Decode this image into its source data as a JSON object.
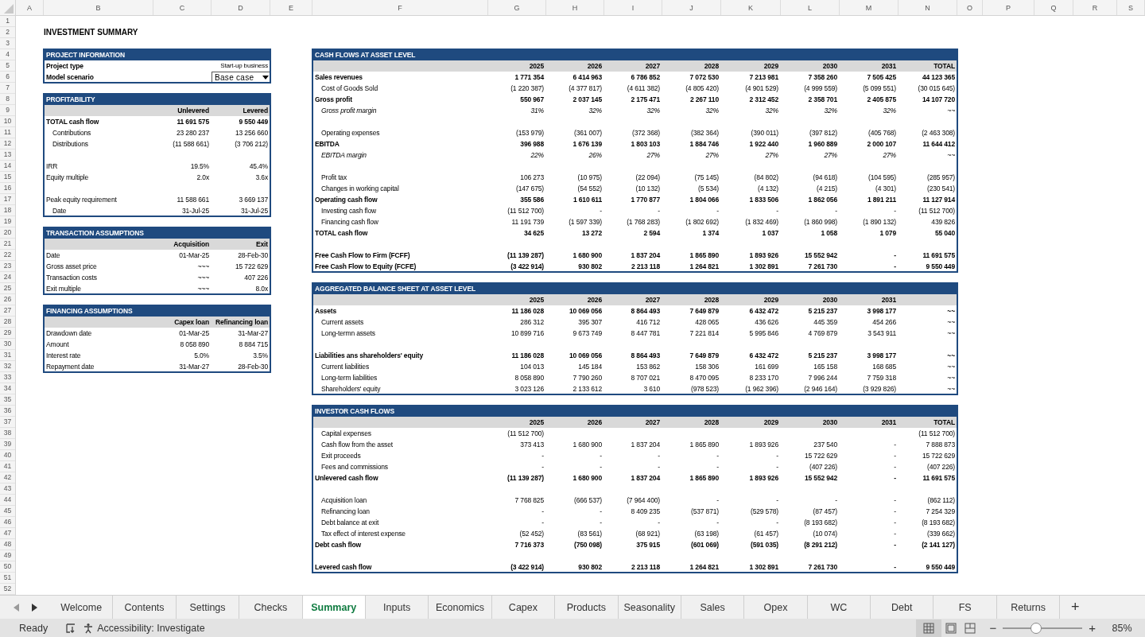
{
  "column_headers": [
    "A",
    "B",
    "C",
    "D",
    "E",
    "F",
    "G",
    "H",
    "I",
    "J",
    "K",
    "L",
    "M",
    "N",
    "O",
    "P",
    "Q",
    "R",
    "S"
  ],
  "row_numbers": [
    "1",
    "2",
    "3",
    "4",
    "5",
    "6",
    "7",
    "8",
    "9",
    "10",
    "11",
    "12",
    "13",
    "14",
    "15",
    "16",
    "17",
    "18",
    "19",
    "20",
    "21",
    "22",
    "23",
    "24",
    "25",
    "26",
    "27",
    "28",
    "29",
    "30",
    "31",
    "32",
    "33",
    "34",
    "35",
    "36",
    "37",
    "38",
    "39",
    "40",
    "41",
    "42",
    "43",
    "44",
    "45",
    "46",
    "47",
    "48",
    "49",
    "50",
    "51",
    "52"
  ],
  "title": "INVESTMENT SUMMARY",
  "left_sections": [
    {
      "title": "PROJECT INFORMATION",
      "rows": [
        {
          "kind": "field",
          "label": "Project type",
          "values": [
            "Start-up business"
          ]
        },
        {
          "kind": "dropdown",
          "label": "Model scenario",
          "values": [
            "Base case"
          ]
        }
      ]
    },
    {
      "title": "PROFITABILITY",
      "columns": [
        "Unlevered",
        "Levered"
      ],
      "rows": [
        {
          "kind": "bold",
          "label": "TOTAL cash flow",
          "values": [
            "11 691 575",
            "9 550 449"
          ]
        },
        {
          "kind": "sub",
          "label": "Contributions",
          "values": [
            "23 280 237",
            "13 256 660"
          ]
        },
        {
          "kind": "sub",
          "label": "Distributions",
          "values": [
            "(11 588 661)",
            "(3 706 212)"
          ]
        },
        {
          "kind": "blank"
        },
        {
          "kind": "plain",
          "label": "IRR",
          "values": [
            "19.5%",
            "45.4%"
          ]
        },
        {
          "kind": "plain",
          "label": "Equity multiple",
          "values": [
            "2.0x",
            "3.6x"
          ]
        },
        {
          "kind": "blank"
        },
        {
          "kind": "plain",
          "label": "Peak equity requirement",
          "values": [
            "11 588 661",
            "3 669 137"
          ]
        },
        {
          "kind": "sub",
          "label": "Date",
          "values": [
            "31-Jul-25",
            "31-Jul-25"
          ]
        }
      ]
    },
    {
      "title": "TRANSACTION ASSUMPTIONS",
      "columns": [
        "Acquisition",
        "Exit"
      ],
      "rows": [
        {
          "kind": "plain",
          "label": "Date",
          "values": [
            "01-Mar-25",
            "28-Feb-30"
          ]
        },
        {
          "kind": "plain",
          "label": "Gross asset price",
          "values": [
            "~~~",
            "15 722 629"
          ]
        },
        {
          "kind": "plain",
          "label": "Transaction costs",
          "values": [
            "~~~",
            "407 226"
          ]
        },
        {
          "kind": "plain",
          "label": "Exit multiple",
          "values": [
            "~~~",
            "8.0x"
          ]
        }
      ]
    },
    {
      "title": "FINANCING ASSUMPTIONS",
      "columns": [
        "Capex loan",
        "Refinancing loan"
      ],
      "rows": [
        {
          "kind": "plain",
          "label": "Drawdown date",
          "values": [
            "01-Mar-25",
            "31-Mar-27"
          ]
        },
        {
          "kind": "plain",
          "label": "Amount",
          "values": [
            "8 058 890",
            "8 884 715"
          ]
        },
        {
          "kind": "plain",
          "label": "Interest rate",
          "values": [
            "5.0%",
            "3.5%"
          ]
        },
        {
          "kind": "plain",
          "label": "Repayment date",
          "values": [
            "31-Mar-27",
            "28-Feb-30"
          ]
        }
      ]
    }
  ],
  "right_sections": [
    {
      "title": "CASH FLOWS AT ASSET LEVEL",
      "columns": [
        "2025",
        "2026",
        "2027",
        "2028",
        "2029",
        "2030",
        "2031",
        "TOTAL"
      ],
      "rows": [
        {
          "kind": "bold",
          "label": "Sales revenues",
          "values": [
            "1 771 354",
            "6 414 963",
            "6 786 852",
            "7 072 530",
            "7 213 981",
            "7 358 260",
            "7 505 425",
            "44 123 365"
          ]
        },
        {
          "kind": "sub",
          "label": "Cost of Goods Sold",
          "values": [
            "(1 220 387)",
            "(4 377 817)",
            "(4 611 382)",
            "(4 805 420)",
            "(4 901 529)",
            "(4 999 559)",
            "(5 099 551)",
            "(30 015 645)"
          ]
        },
        {
          "kind": "bold",
          "label": "Gross profit",
          "values": [
            "550 967",
            "2 037 145",
            "2 175 471",
            "2 267 110",
            "2 312 452",
            "2 358 701",
            "2 405 875",
            "14 107 720"
          ]
        },
        {
          "kind": "italic",
          "label": "Gross profit margin",
          "values": [
            "31%",
            "32%",
            "32%",
            "32%",
            "32%",
            "32%",
            "32%",
            "~~"
          ]
        },
        {
          "kind": "blank"
        },
        {
          "kind": "sub",
          "label": "Operating expenses",
          "values": [
            "(153 979)",
            "(361 007)",
            "(372 368)",
            "(382 364)",
            "(390 011)",
            "(397 812)",
            "(405 768)",
            "(2 463 308)"
          ]
        },
        {
          "kind": "bold",
          "label": "EBITDA",
          "values": [
            "396 988",
            "1 676 139",
            "1 803 103",
            "1 884 746",
            "1 922 440",
            "1 960 889",
            "2 000 107",
            "11 644 412"
          ]
        },
        {
          "kind": "italic",
          "label": "EBITDA margin",
          "values": [
            "22%",
            "26%",
            "27%",
            "27%",
            "27%",
            "27%",
            "27%",
            "~~"
          ]
        },
        {
          "kind": "blank"
        },
        {
          "kind": "sub",
          "label": "Profit tax",
          "values": [
            "106 273",
            "(10 975)",
            "(22 094)",
            "(75 145)",
            "(84 802)",
            "(94 618)",
            "(104 595)",
            "(285 957)"
          ]
        },
        {
          "kind": "sub",
          "label": "Changes in working capital",
          "values": [
            "(147 675)",
            "(54 552)",
            "(10 132)",
            "(5 534)",
            "(4 132)",
            "(4 215)",
            "(4 301)",
            "(230 541)"
          ]
        },
        {
          "kind": "bold",
          "label": "Operating cash flow",
          "values": [
            "355 586",
            "1 610 611",
            "1 770 877",
            "1 804 066",
            "1 833 506",
            "1 862 056",
            "1 891 211",
            "11 127 914"
          ]
        },
        {
          "kind": "sub",
          "label": "Investing cash flow",
          "values": [
            "(11 512 700)",
            "-",
            "-",
            "-",
            "-",
            "-",
            "-",
            "(11 512 700)"
          ]
        },
        {
          "kind": "sub",
          "label": "Financing cash flow",
          "values": [
            "11 191 739",
            "(1 597 339)",
            "(1 768 283)",
            "(1 802 692)",
            "(1 832 469)",
            "(1 860 998)",
            "(1 890 132)",
            "439 826"
          ]
        },
        {
          "kind": "bold",
          "label": "TOTAL cash flow",
          "values": [
            "34 625",
            "13 272",
            "2 594",
            "1 374",
            "1 037",
            "1 058",
            "1 079",
            "55 040"
          ]
        },
        {
          "kind": "blank"
        },
        {
          "kind": "bold",
          "label": "Free Cash Flow to Firm (FCFF)",
          "values": [
            "(11 139 287)",
            "1 680 900",
            "1 837 204",
            "1 865 890",
            "1 893 926",
            "15 552 942",
            "-",
            "11 691 575"
          ]
        },
        {
          "kind": "bold",
          "label": "Free Cash Flow to Equity (FCFE)",
          "values": [
            "(3 422 914)",
            "930 802",
            "2 213 118",
            "1 264 821",
            "1 302 891",
            "7 261 730",
            "-",
            "9 550 449"
          ]
        }
      ]
    },
    {
      "title": "AGGREGATED BALANCE SHEET AT ASSET LEVEL",
      "columns": [
        "2025",
        "2026",
        "2027",
        "2028",
        "2029",
        "2030",
        "2031"
      ],
      "rows": [
        {
          "kind": "bold",
          "label": "Assets",
          "values": [
            "11 186 028",
            "10 069 056",
            "8 864 493",
            "7 649 879",
            "6 432 472",
            "5 215 237",
            "3 998 177",
            "~~"
          ]
        },
        {
          "kind": "sub",
          "label": "Current assets",
          "values": [
            "286 312",
            "395 307",
            "416 712",
            "428 065",
            "436 626",
            "445 359",
            "454 266",
            "~~"
          ]
        },
        {
          "kind": "sub",
          "label": "Long-termn assets",
          "values": [
            "10 899 716",
            "9 673 749",
            "8 447 781",
            "7 221 814",
            "5 995 846",
            "4 769 879",
            "3 543 911",
            "~~"
          ]
        },
        {
          "kind": "blank"
        },
        {
          "kind": "bold",
          "label": "Liabilities ans shareholders' equity",
          "values": [
            "11 186 028",
            "10 069 056",
            "8 864 493",
            "7 649 879",
            "6 432 472",
            "5 215 237",
            "3 998 177",
            "~~"
          ]
        },
        {
          "kind": "sub",
          "label": "Current liabilities",
          "values": [
            "104 013",
            "145 184",
            "153 862",
            "158 306",
            "161 699",
            "165 158",
            "168 685",
            "~~"
          ]
        },
        {
          "kind": "sub",
          "label": "Long-term liabilities",
          "values": [
            "8 058 890",
            "7 790 260",
            "8 707 021",
            "8 470 095",
            "8 233 170",
            "7 996 244",
            "7 759 318",
            "~~"
          ]
        },
        {
          "kind": "sub",
          "label": "Shareholders' equity",
          "values": [
            "3 023 126",
            "2 133 612",
            "3 610",
            "(978 523)",
            "(1 962 396)",
            "(2 946 164)",
            "(3 929 826)",
            "~~"
          ]
        }
      ]
    },
    {
      "title": "INVESTOR CASH FLOWS",
      "columns": [
        "2025",
        "2026",
        "2027",
        "2028",
        "2029",
        "2030",
        "2031",
        "TOTAL"
      ],
      "rows": [
        {
          "kind": "sub",
          "label": "Capital expenses",
          "values": [
            "(11 512 700)"
          ],
          "total": "(11 512 700)"
        },
        {
          "kind": "sub",
          "label": "Cash flow from the asset",
          "values": [
            "373 413",
            "1 680 900",
            "1 837 204",
            "1 865 890",
            "1 893 926",
            "237 540",
            "-",
            "7 888 873"
          ]
        },
        {
          "kind": "sub",
          "label": "Exit proceeds",
          "values": [
            "-",
            "-",
            "-",
            "-",
            "-",
            "15 722 629",
            "-",
            "15 722 629"
          ]
        },
        {
          "kind": "sub",
          "label": "Fees and commissions",
          "values": [
            "-",
            "-",
            "-",
            "-",
            "-",
            "(407 226)",
            "-",
            "(407 226)"
          ]
        },
        {
          "kind": "bold",
          "label": "Unlevered cash flow",
          "values": [
            "(11 139 287)",
            "1 680 900",
            "1 837 204",
            "1 865 890",
            "1 893 926",
            "15 552 942",
            "-",
            "11 691 575"
          ]
        },
        {
          "kind": "blank"
        },
        {
          "kind": "sub",
          "label": "Acquisition loan",
          "values": [
            "7 768 825",
            "(666 537)",
            "(7 964 400)",
            "-",
            "-",
            "-",
            "-",
            "(862 112)"
          ]
        },
        {
          "kind": "sub",
          "label": "Refinancing loan",
          "values": [
            "-",
            "-",
            "8 409 235",
            "(537 871)",
            "(529 578)",
            "(87 457)",
            "-",
            "7 254 329"
          ]
        },
        {
          "kind": "sub",
          "label": "Debt balance at exit",
          "values": [
            "-",
            "-",
            "-",
            "-",
            "-",
            "(8 193 682)",
            "-",
            "(8 193 682)"
          ]
        },
        {
          "kind": "sub",
          "label": "Tax effect of interest expense",
          "values": [
            "(52 452)",
            "(83 561)",
            "(68 921)",
            "(63 198)",
            "(61 457)",
            "(10 074)",
            "-",
            "(339 662)"
          ]
        },
        {
          "kind": "bold",
          "label": "Debt cash flow",
          "values": [
            "7 716 373",
            "(750 098)",
            "375 915",
            "(601 069)",
            "(591 035)",
            "(8 291 212)",
            "-",
            "(2 141 127)"
          ]
        },
        {
          "kind": "blank"
        },
        {
          "kind": "bold",
          "label": "Levered cash flow",
          "values": [
            "(3 422 914)",
            "930 802",
            "2 213 118",
            "1 264 821",
            "1 302 891",
            "7 261 730",
            "-",
            "9 550 449"
          ]
        }
      ]
    }
  ],
  "tabs": [
    {
      "label": "Welcome",
      "selected": false
    },
    {
      "label": "Contents",
      "selected": false
    },
    {
      "label": "Settings",
      "selected": false
    },
    {
      "label": "Checks",
      "selected": false
    },
    {
      "label": "Summary",
      "selected": true
    },
    {
      "label": "Inputs",
      "selected": false
    },
    {
      "label": "Economics",
      "selected": false
    },
    {
      "label": "Capex",
      "selected": false
    },
    {
      "label": "Products",
      "selected": false
    },
    {
      "label": "Seasonality",
      "selected": false
    },
    {
      "label": "Sales",
      "selected": false
    },
    {
      "label": "Opex",
      "selected": false
    },
    {
      "label": "WC",
      "selected": false
    },
    {
      "label": "Debt",
      "selected": false
    },
    {
      "label": "FS",
      "selected": false
    },
    {
      "label": "Returns",
      "selected": false
    }
  ],
  "add_sheet": "+",
  "status_bar": {
    "status": "Ready",
    "accessibility": "Accessibility: Investigate",
    "zoom_out": "−",
    "zoom_in": "+",
    "zoom": {
      "level": 0.42
    },
    "zoom_reading": "85%"
  }
}
